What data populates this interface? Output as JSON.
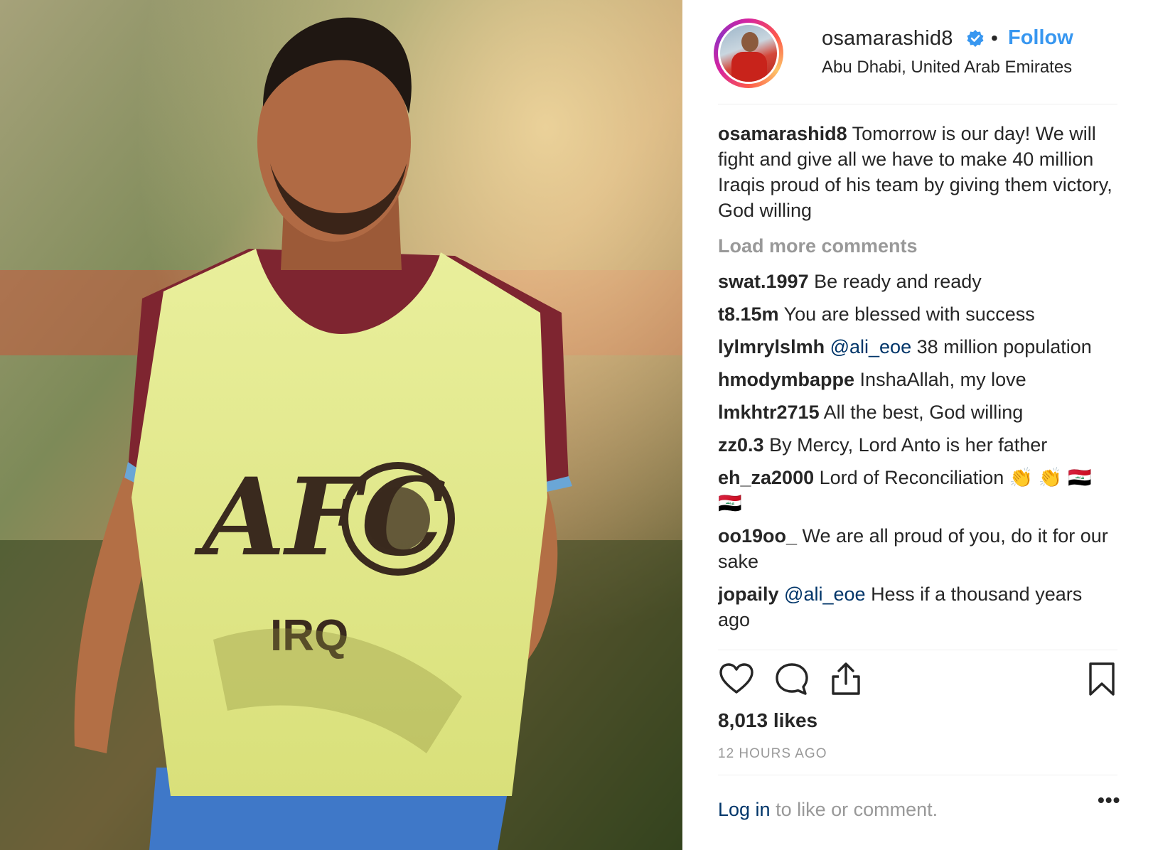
{
  "post": {
    "username": "osamarashid8",
    "follow_label": "Follow",
    "separator": "•",
    "location": "Abu Dhabi, United Arab Emirates",
    "image": {
      "bib_logo_text": "AFC",
      "bib_country_text": "IRQ"
    }
  },
  "caption": {
    "user": "osamarashid8",
    "text": "Tomorrow is our day! We will fight and give all we have to make 40 million Iraqis proud of his team by giving them victory, God willing"
  },
  "load_more_label": "Load more comments",
  "comments": [
    {
      "user": "swat.1997",
      "mention": "",
      "text": "Be ready and ready"
    },
    {
      "user": "t8.15m",
      "mention": "",
      "text": "You are blessed with success"
    },
    {
      "user": "lylmrylslmh",
      "mention": "@ali_eoe",
      "text": "38 million population"
    },
    {
      "user": "hmodymbappe",
      "mention": "",
      "text": "InshaAllah, my love"
    },
    {
      "user": "lmkhtr2715",
      "mention": "",
      "text": "All the best, God willing"
    },
    {
      "user": "zz0.3",
      "mention": "",
      "text": "By Mercy, Lord Anto is her father"
    },
    {
      "user": "eh_za2000",
      "mention": "",
      "text": "Lord of Reconciliation 👏 👏 🇮🇶 🇮🇶"
    },
    {
      "user": "oo19oo_",
      "mention": "",
      "text": "We are all proud of you, do it for our sake"
    },
    {
      "user": "jopaily",
      "mention": "@ali_eoe",
      "text": "Hess if a thousand years ago"
    }
  ],
  "actions": {
    "like_icon": "heart-icon",
    "comment_icon": "comment-icon",
    "share_icon": "share-icon",
    "save_icon": "bookmark-icon"
  },
  "likes_label": "8,013 likes",
  "time_label": "12 HOURS AGO",
  "footer": {
    "login_link": "Log in",
    "login_rest": " to like or comment.",
    "more_label": "•••"
  },
  "colors": {
    "link_blue": "#3897f0",
    "mention_blue": "#003569",
    "muted_gray": "#999999",
    "text": "#262626"
  }
}
